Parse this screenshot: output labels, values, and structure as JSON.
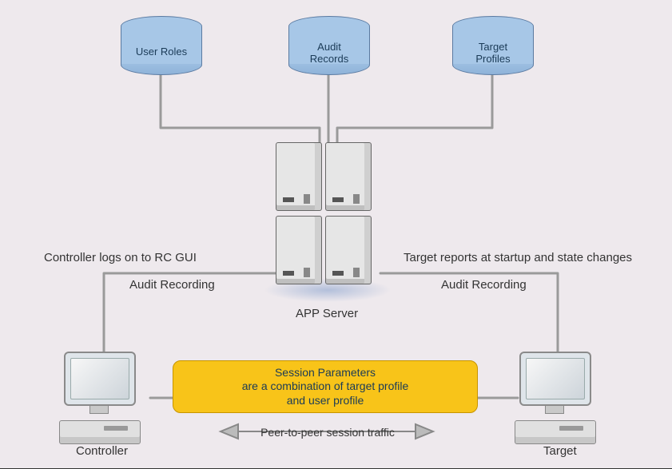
{
  "databases": {
    "user_roles": "User Roles",
    "audit_records": "Audit\nRecords",
    "target_profiles": "Target\nProfiles"
  },
  "server_label": "APP Server",
  "captions": {
    "controller_logs": "Controller logs on to RC GUI",
    "target_reports": "Target reports at startup and state changes",
    "audit_left": "Audit Recording",
    "audit_right": "Audit Recording"
  },
  "session_box": {
    "line1": "Session Parameters",
    "line2": "are a combination of target profile",
    "line3": "and user profile"
  },
  "p2p_label": "Peer-to-peer session traffic",
  "endpoints": {
    "controller": "Controller",
    "target": "Target"
  }
}
